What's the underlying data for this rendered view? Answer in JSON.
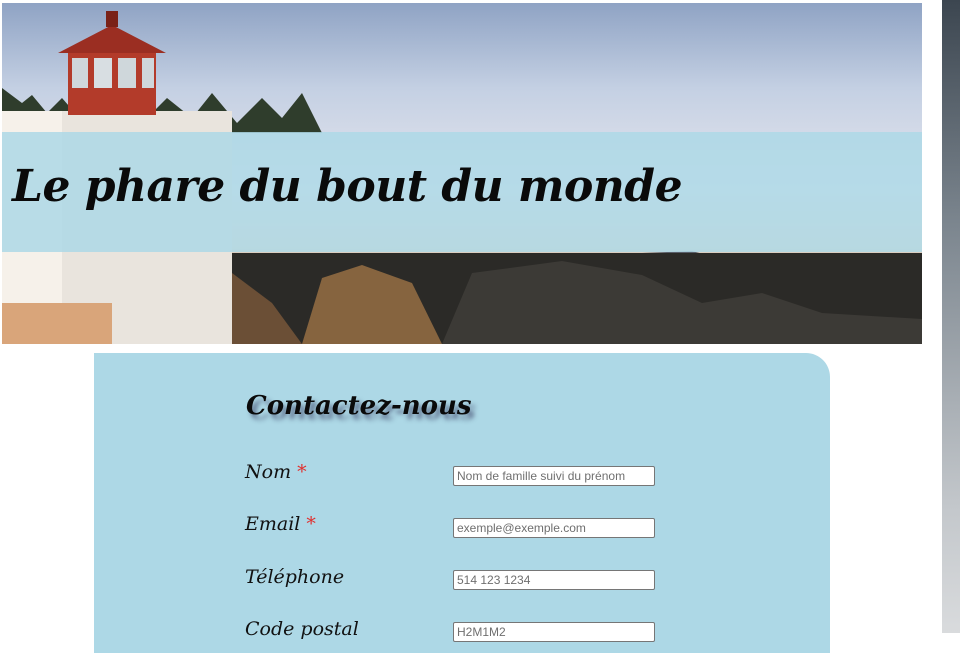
{
  "header": {
    "site_title": "Le phare du bout du monde"
  },
  "contact": {
    "heading": "Contactez-nous",
    "required_marker": "*",
    "fields": [
      {
        "label": "Nom",
        "required": true,
        "placeholder": "Nom de famille suivi du prénom"
      },
      {
        "label": "Email",
        "required": true,
        "placeholder": "exemple@exemple.com"
      },
      {
        "label": "Téléphone",
        "required": false,
        "placeholder": "514 123 1234"
      },
      {
        "label": "Code postal",
        "required": false,
        "placeholder": "H2M1M2"
      }
    ]
  },
  "colors": {
    "panel": "#add8e6",
    "required": "#e0302f"
  }
}
